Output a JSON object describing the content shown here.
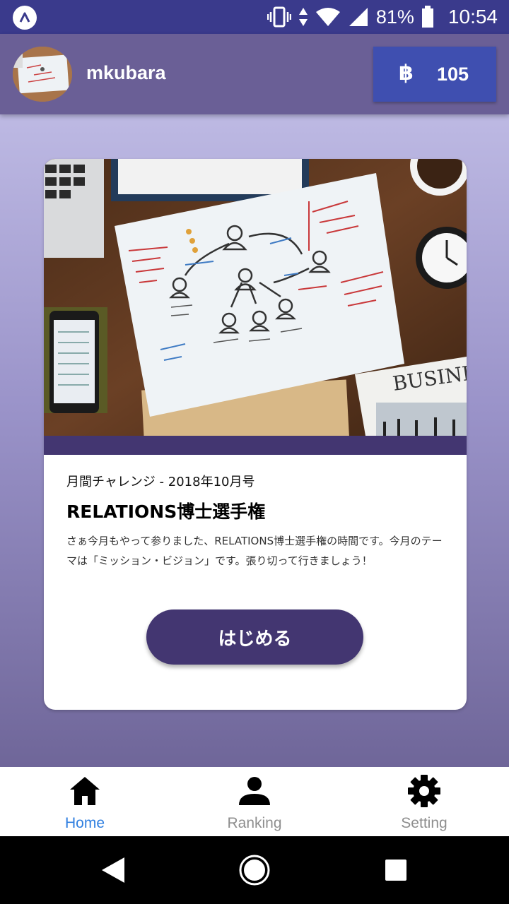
{
  "status_bar": {
    "battery": "81%",
    "time": "10:54",
    "icons": [
      "app-logo-icon",
      "vibrate-icon",
      "data-arrows-icon",
      "wifi-icon",
      "signal-icon",
      "battery-icon"
    ]
  },
  "header": {
    "username": "mkubara",
    "coin_symbol": "฿",
    "coin_count": "105"
  },
  "card": {
    "subtitle": "月間チャレンジ - 2018年10月号",
    "title": "RELATIONS博士選手権",
    "description": "さぁ今月もやって参りました、RELATIONS博士選手権の時間です。今月のテーマは「ミッション・ビジョン」です。張り切って行きましょう！",
    "start_label": "はじめる",
    "image_text": "BUSINE"
  },
  "tabs": [
    {
      "label": "Home",
      "icon": "home-icon",
      "active": true
    },
    {
      "label": "Ranking",
      "icon": "person-icon",
      "active": false
    },
    {
      "label": "Setting",
      "icon": "gear-icon",
      "active": false
    }
  ],
  "colors": {
    "status_bar": "#3a3a8c",
    "header": "#6a5f96",
    "coin_box": "#3f4fb0",
    "primary": "#433671",
    "tab_active": "#2f7fe0",
    "tab_inactive": "#8e8e8e"
  }
}
